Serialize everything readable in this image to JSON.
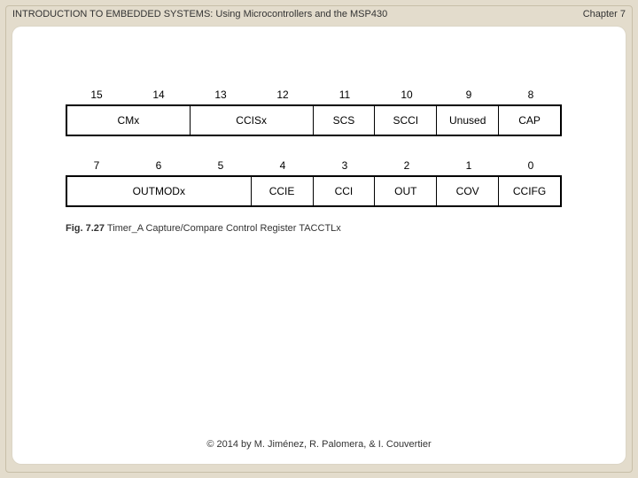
{
  "header": {
    "title": "INTRODUCTION TO EMBEDDED SYSTEMS: Using Microcontrollers and the MSP430",
    "chapter": "Chapter 7"
  },
  "bits_upper": [
    "15",
    "14",
    "13",
    "12",
    "11",
    "10",
    "9",
    "8"
  ],
  "bits_lower": [
    "7",
    "6",
    "5",
    "4",
    "3",
    "2",
    "1",
    "0"
  ],
  "row_upper": {
    "c0": "CMx",
    "c1": "CCISx",
    "c2": "SCS",
    "c3": "SCCI",
    "c4": "Unused",
    "c5": "CAP"
  },
  "row_lower": {
    "c0": "OUTMODx",
    "c1": "CCIE",
    "c2": "CCI",
    "c3": "OUT",
    "c4": "COV",
    "c5": "CCIFG"
  },
  "caption": {
    "fignum": "Fig. 7.27",
    "text": "Timer_A Capture/Compare Control Register TACCTLx"
  },
  "footer": "© 2014 by M. Jiménez, R. Palomera, & I. Couvertier"
}
